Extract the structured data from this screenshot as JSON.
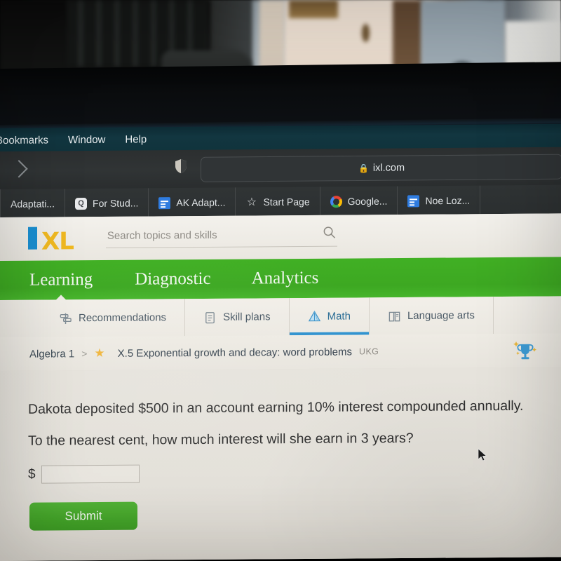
{
  "browser": {
    "menubar": {
      "items": [
        {
          "label": "Bookmarks"
        },
        {
          "label": "Window"
        },
        {
          "label": "Help"
        }
      ]
    },
    "toolbar": {
      "forward_icon": "chevron-right-icon",
      "shield_icon": "shield-icon",
      "url": "ixl.com",
      "lock_icon": "lock-icon"
    },
    "bookmarks": [
      {
        "label": "Adaptati...",
        "icon": "bookmark-icon"
      },
      {
        "label": "For Stud...",
        "icon": "q-app-icon"
      },
      {
        "label": "AK Adapt...",
        "icon": "doc-icon"
      },
      {
        "label": "Start Page",
        "icon": "star-outline-icon"
      },
      {
        "label": "Google...",
        "icon": "google-icon"
      },
      {
        "label": "Noe Loz...",
        "icon": "doc-icon"
      }
    ]
  },
  "site": {
    "logo": {
      "i": "I",
      "xl": "XL"
    },
    "search": {
      "placeholder": "Search topics and skills",
      "value": "",
      "icon": "search-icon"
    },
    "primary_nav": [
      {
        "label": "Learning",
        "active": true
      },
      {
        "label": "Diagnostic",
        "active": false
      },
      {
        "label": "Analytics",
        "active": false
      }
    ],
    "sub_nav": [
      {
        "label": "Recommendations",
        "icon": "signpost-icon",
        "active": false
      },
      {
        "label": "Skill plans",
        "icon": "checklist-icon",
        "active": false
      },
      {
        "label": "Math",
        "icon": "pyramid-icon",
        "active": true
      },
      {
        "label": "Language arts",
        "icon": "open-book-icon",
        "active": false
      }
    ],
    "breadcrumb": {
      "grade": "Algebra 1",
      "separator": ">",
      "star_icon": "star-filled-icon",
      "skill": "X.5 Exponential growth and decay: word problems",
      "badge": "UKG",
      "trophy_icon": "trophy-icon"
    },
    "question": {
      "line1": "Dakota deposited $500 in an account earning 10% interest compounded annually.",
      "line2": "To the nearest cent, how much interest will she earn in 3 years?",
      "answer_prefix": "$",
      "answer_value": "",
      "submit_label": "Submit"
    }
  },
  "colors": {
    "brand_green": "#3FAF23",
    "brand_blue": "#1A8FD1",
    "brand_yellow": "#F0B921",
    "tab_active_blue": "#2F92CF",
    "submit_green": "#43A328"
  }
}
